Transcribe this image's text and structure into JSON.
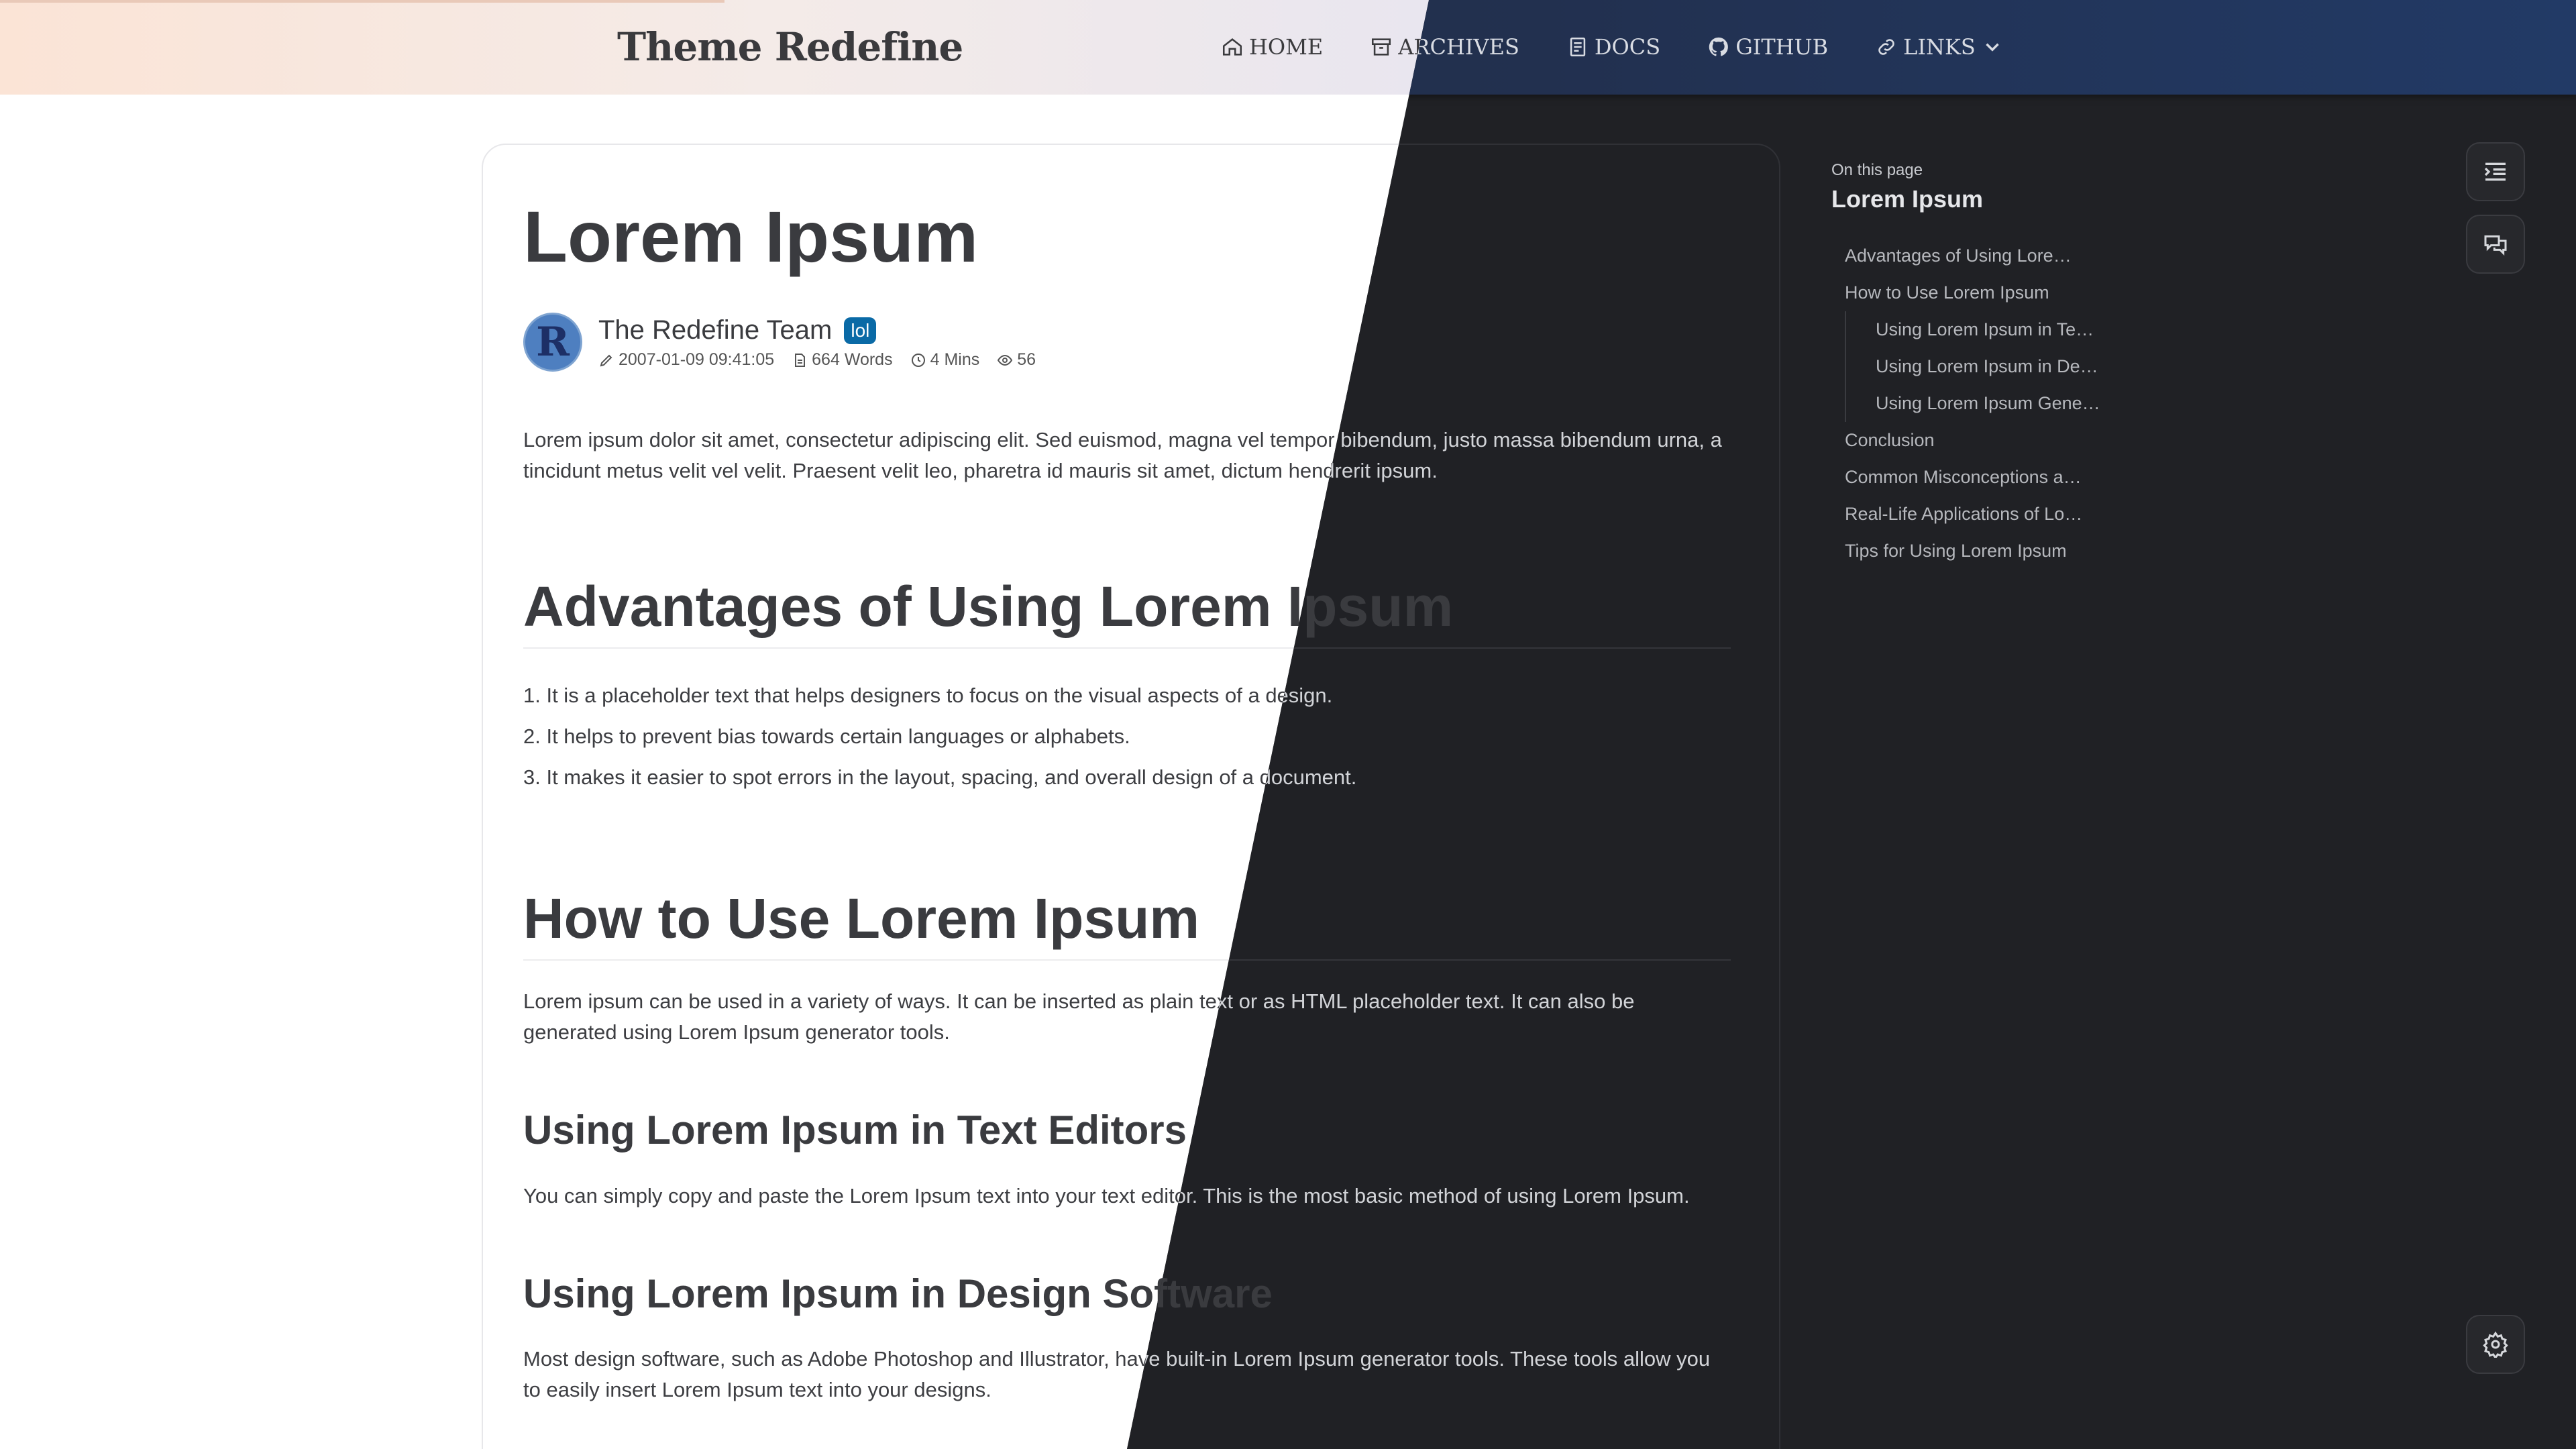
{
  "brand": "Theme Redefine",
  "nav": [
    {
      "label": "HOME",
      "icon": "home-icon"
    },
    {
      "label": "ARCHIVES",
      "icon": "archive-icon"
    },
    {
      "label": "DOCS",
      "icon": "docs-icon"
    },
    {
      "label": "GITHUB",
      "icon": "github-icon"
    },
    {
      "label": "LINKS",
      "icon": "link-icon"
    }
  ],
  "post": {
    "title": "Lorem Ipsum",
    "author": "The Redefine Team",
    "badge": "lol",
    "avatar_letter": "R",
    "date": "2007-01-09 09:41:05",
    "words": "664 Words",
    "read_time": "4 Mins",
    "views": "56",
    "intro": "Lorem ipsum dolor sit amet, consectetur adipiscing elit. Sed euismod, magna vel tempor bibendum, justo massa bibendum urna, a tincidunt metus velit vel velit. Praesent velit leo, pharetra id mauris sit amet, dictum hendrerit ipsum.",
    "sec1_title": "Advantages of Using Lorem Ipsum",
    "sec1_items": [
      "1. It is a placeholder text that helps designers to focus on the visual aspects of a design.",
      "2. It helps to prevent bias towards certain languages or alphabets.",
      "3. It makes it easier to spot errors in the layout, spacing, and overall design of a document."
    ],
    "sec2_title": "How to Use Lorem Ipsum",
    "sec2_para": "Lorem ipsum can be used in a variety of ways. It can be inserted as plain text or as HTML placeholder text. It can also be generated using Lorem Ipsum generator tools.",
    "sub1_title": "Using Lorem Ipsum in Text Editors",
    "sub1_para": "You can simply copy and paste the Lorem Ipsum text into your text editor. This is the most basic method of using Lorem Ipsum.",
    "sub2_title": "Using Lorem Ipsum in Design Software",
    "sub2_para": "Most design software, such as Adobe Photoshop and Illustrator, have built-in Lorem Ipsum generator tools. These tools allow you to easily insert Lorem Ipsum text into your designs."
  },
  "toc": {
    "heading": "On this page",
    "title": "Lorem Ipsum",
    "items": [
      {
        "label": "Advantages of Using Lorem Ipsum",
        "level": 1
      },
      {
        "label": "How to Use Lorem Ipsum",
        "level": 1
      },
      {
        "label": "Using Lorem Ipsum in Text Editors",
        "level": 2
      },
      {
        "label": "Using Lorem Ipsum in Design Software",
        "level": 2
      },
      {
        "label": "Using Lorem Ipsum Generators",
        "level": 2
      },
      {
        "label": "Conclusion",
        "level": 1
      },
      {
        "label": "Common Misconceptions about Lorem Ipsum",
        "level": 1
      },
      {
        "label": "Real-Life Applications of Lorem Ipsum",
        "level": 1
      },
      {
        "label": "Tips for Using Lorem Ipsum",
        "level": 1
      }
    ]
  },
  "colors": {
    "light_bg": "#ffffff",
    "dark_bg": "#202125",
    "badge": "#0a6aa6",
    "header_dark": "#22304f"
  }
}
